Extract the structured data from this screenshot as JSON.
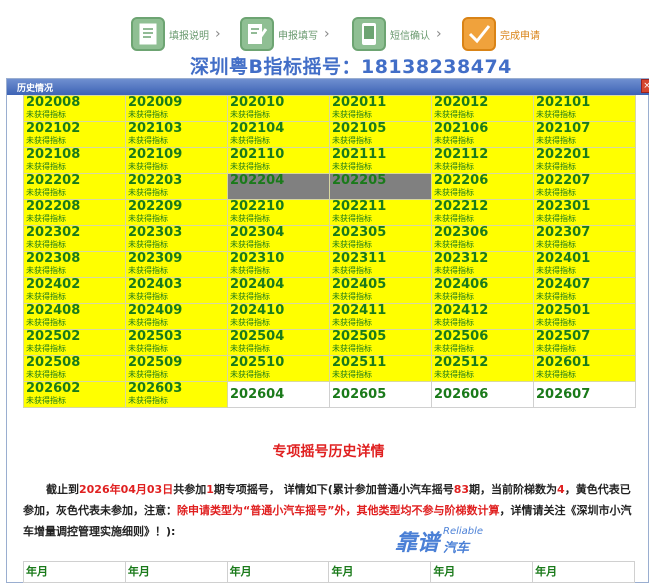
{
  "steps": [
    {
      "label": "填报说明",
      "state": "done"
    },
    {
      "label": "申报填写",
      "state": "done"
    },
    {
      "label": "短信确认",
      "state": "done"
    },
    {
      "label": "完成申请",
      "state": "active"
    }
  ],
  "watermark_title": "深圳粤B指标摇号：18138238474",
  "dialog": {
    "title": "历史情况",
    "close": "×"
  },
  "grid_rows": [
    [
      [
        "202008",
        "未获得指标",
        "y"
      ],
      [
        "202009",
        "未获得指标",
        "y"
      ],
      [
        "202010",
        "未获得指标",
        "y"
      ],
      [
        "202011",
        "未获得指标",
        "y"
      ],
      [
        "202012",
        "未获得指标",
        "y"
      ],
      [
        "202101",
        "未获得指标",
        "y"
      ]
    ],
    [
      [
        "202102",
        "未获得指标",
        "y"
      ],
      [
        "202103",
        "未获得指标",
        "y"
      ],
      [
        "202104",
        "未获得指标",
        "y"
      ],
      [
        "202105",
        "未获得指标",
        "y"
      ],
      [
        "202106",
        "未获得指标",
        "y"
      ],
      [
        "202107",
        "未获得指标",
        "y"
      ]
    ],
    [
      [
        "202108",
        "未获得指标",
        "y"
      ],
      [
        "202109",
        "未获得指标",
        "y"
      ],
      [
        "202110",
        "未获得指标",
        "y"
      ],
      [
        "202111",
        "未获得指标",
        "y"
      ],
      [
        "202112",
        "未获得指标",
        "y"
      ],
      [
        "202201",
        "未获得指标",
        "y"
      ]
    ],
    [
      [
        "202202",
        "未获得指标",
        "y"
      ],
      [
        "202203",
        "未获得指标",
        "y"
      ],
      [
        "202204",
        "",
        "g"
      ],
      [
        "202205",
        "",
        "g"
      ],
      [
        "202206",
        "未获得指标",
        "y"
      ],
      [
        "202207",
        "未获得指标",
        "y"
      ]
    ],
    [
      [
        "202208",
        "未获得指标",
        "y"
      ],
      [
        "202209",
        "未获得指标",
        "y"
      ],
      [
        "202210",
        "未获得指标",
        "y"
      ],
      [
        "202211",
        "未获得指标",
        "y"
      ],
      [
        "202212",
        "未获得指标",
        "y"
      ],
      [
        "202301",
        "未获得指标",
        "y"
      ]
    ],
    [
      [
        "202302",
        "未获得指标",
        "y"
      ],
      [
        "202303",
        "未获得指标",
        "y"
      ],
      [
        "202304",
        "未获得指标",
        "y"
      ],
      [
        "202305",
        "未获得指标",
        "y"
      ],
      [
        "202306",
        "未获得指标",
        "y"
      ],
      [
        "202307",
        "未获得指标",
        "y"
      ]
    ],
    [
      [
        "202308",
        "未获得指标",
        "y"
      ],
      [
        "202309",
        "未获得指标",
        "y"
      ],
      [
        "202310",
        "未获得指标",
        "y"
      ],
      [
        "202311",
        "未获得指标",
        "y"
      ],
      [
        "202312",
        "未获得指标",
        "y"
      ],
      [
        "202401",
        "未获得指标",
        "y"
      ]
    ],
    [
      [
        "202402",
        "未获得指标",
        "y"
      ],
      [
        "202403",
        "未获得指标",
        "y"
      ],
      [
        "202404",
        "未获得指标",
        "y"
      ],
      [
        "202405",
        "未获得指标",
        "y"
      ],
      [
        "202406",
        "未获得指标",
        "y"
      ],
      [
        "202407",
        "未获得指标",
        "y"
      ]
    ],
    [
      [
        "202408",
        "未获得指标",
        "y"
      ],
      [
        "202409",
        "未获得指标",
        "y"
      ],
      [
        "202410",
        "未获得指标",
        "y"
      ],
      [
        "202411",
        "未获得指标",
        "y"
      ],
      [
        "202412",
        "未获得指标",
        "y"
      ],
      [
        "202501",
        "未获得指标",
        "y"
      ]
    ],
    [
      [
        "202502",
        "未获得指标",
        "y"
      ],
      [
        "202503",
        "未获得指标",
        "y"
      ],
      [
        "202504",
        "未获得指标",
        "y"
      ],
      [
        "202505",
        "未获得指标",
        "y"
      ],
      [
        "202506",
        "未获得指标",
        "y"
      ],
      [
        "202507",
        "未获得指标",
        "y"
      ]
    ],
    [
      [
        "202508",
        "未获得指标",
        "y"
      ],
      [
        "202509",
        "未获得指标",
        "y"
      ],
      [
        "202510",
        "未获得指标",
        "y"
      ],
      [
        "202511",
        "未获得指标",
        "y"
      ],
      [
        "202512",
        "未获得指标",
        "y"
      ],
      [
        "202601",
        "未获得指标",
        "y"
      ]
    ],
    [
      [
        "202602",
        "未获得指标",
        "y"
      ],
      [
        "202603",
        "未获得指标",
        "y"
      ],
      [
        "202604",
        "",
        "w"
      ],
      [
        "202605",
        "",
        "w"
      ],
      [
        "202606",
        "",
        "w"
      ],
      [
        "202607",
        "",
        "w"
      ]
    ]
  ],
  "special": {
    "title": "专项摇号历史详情",
    "summary_parts": [
      {
        "t": "截止到",
        "c": ""
      },
      {
        "t": "2026年04月03日",
        "c": "red"
      },
      {
        "t": "共参加",
        "c": ""
      },
      {
        "t": "1",
        "c": "red"
      },
      {
        "t": "期专项摇号， 详情如下(累计参加普通小汽车摇号",
        "c": ""
      },
      {
        "t": "83",
        "c": "red"
      },
      {
        "t": "期，当前阶梯数为",
        "c": ""
      },
      {
        "t": "4",
        "c": "red"
      },
      {
        "t": "，黄色代表已参加，灰色代表未参加，注意：",
        "c": ""
      },
      {
        "t": "除申请类型为“普通小汽车摇号”外，其他类型均不参与阶梯数计算",
        "c": "red"
      },
      {
        "t": "，详情请关注《深圳市小汽车增量调控管理实施细则》！):",
        "c": ""
      }
    ]
  },
  "brand": {
    "cn": "靠谱",
    "en_top": "Reliable",
    "en_bottom": "汽车"
  },
  "year_header": [
    "年月",
    "年月",
    "年月",
    "年月",
    "年月",
    "年月"
  ],
  "colors": {
    "accent_orange": "#f0a23c",
    "green_text": "#1a7a1a",
    "yellow": "#ffff00",
    "grey": "#808080",
    "red": "#e02020"
  }
}
